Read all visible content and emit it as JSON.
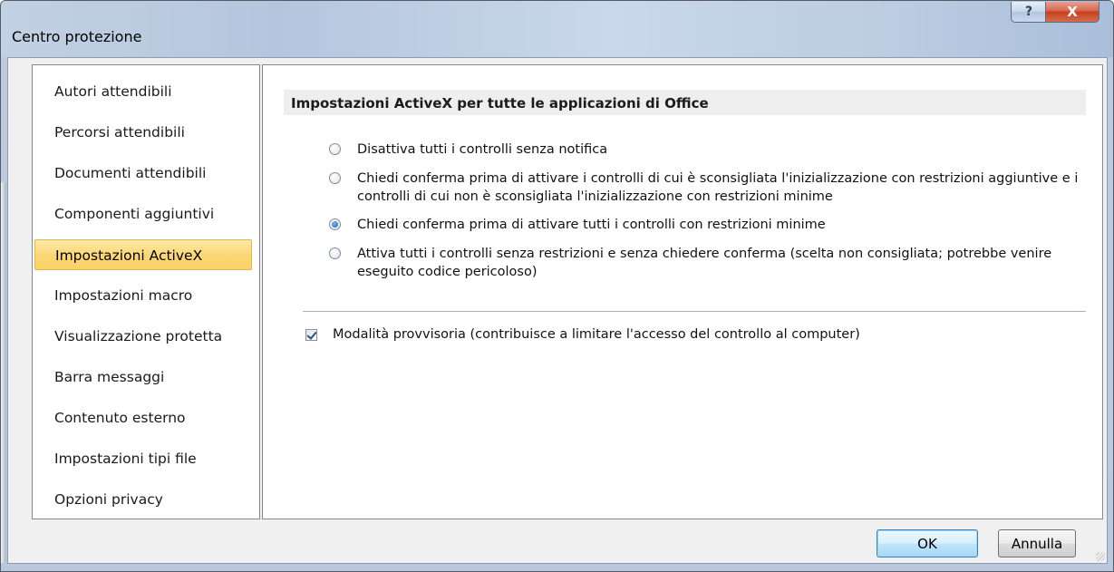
{
  "window": {
    "title": "Centro protezione",
    "help_glyph": "?",
    "close_glyph": "X"
  },
  "sidebar": {
    "items": [
      {
        "label": "Autori attendibili",
        "selected": false
      },
      {
        "label": "Percorsi attendibili",
        "selected": false
      },
      {
        "label": "Documenti attendibili",
        "selected": false
      },
      {
        "label": "Componenti aggiuntivi",
        "selected": false
      },
      {
        "label": "Impostazioni ActiveX",
        "selected": true
      },
      {
        "label": "Impostazioni macro",
        "selected": false
      },
      {
        "label": "Visualizzazione protetta",
        "selected": false
      },
      {
        "label": "Barra messaggi",
        "selected": false
      },
      {
        "label": "Contenuto esterno",
        "selected": false
      },
      {
        "label": "Impostazioni tipi file",
        "selected": false
      },
      {
        "label": "Opzioni privacy",
        "selected": false
      }
    ]
  },
  "main": {
    "section_title": "Impostazioni ActiveX per tutte le applicazioni di Office",
    "options": [
      {
        "label": "Disattiva tutti i controlli senza notifica",
        "checked": false
      },
      {
        "label": "Chiedi conferma prima di attivare i controlli di cui è sconsigliata l'inizializzazione con restrizioni aggiuntive e i controlli di cui non è sconsigliata l'inizializzazione con restrizioni minime",
        "checked": false
      },
      {
        "label": "Chiedi conferma prima di attivare tutti i controlli con restrizioni minime",
        "checked": true
      },
      {
        "label": "Attiva tutti i controlli senza restrizioni e senza chiedere conferma (scelta non consigliata; potrebbe venire eseguito codice pericoloso)",
        "checked": false
      }
    ],
    "safe_mode": {
      "label": "Modalità provvisoria (contribuisce a limitare l'accesso del controllo al computer)",
      "checked": true
    }
  },
  "footer": {
    "ok_label": "OK",
    "cancel_label": "Annulla"
  }
}
